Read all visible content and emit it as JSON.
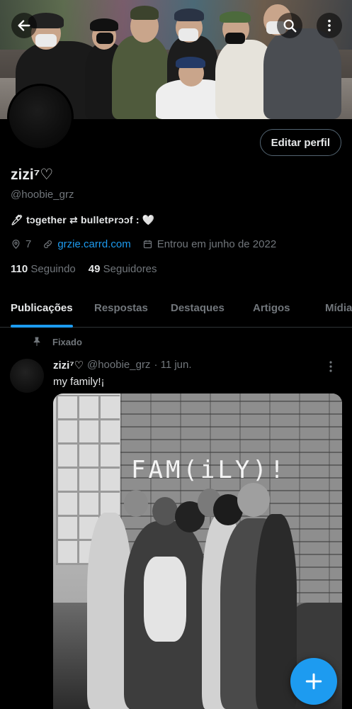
{
  "profile": {
    "display_name": "zizi⁷♡",
    "handle": "@hoobie_grz",
    "bio": "🖊 tɔgether ⇄ bulletᴘrɔɔf : 🤍",
    "location": "7",
    "website": "grzie.carrd.com",
    "joined": "Entrou em junho de 2022",
    "following_count": "110",
    "following_label": "Seguindo",
    "followers_count": "49",
    "followers_label": "Seguidores",
    "edit_button": "Editar perfil"
  },
  "tabs": [
    {
      "label": "Publicações"
    },
    {
      "label": "Respostas"
    },
    {
      "label": "Destaques"
    },
    {
      "label": "Artigos"
    },
    {
      "label": "Mídia"
    }
  ],
  "post": {
    "pinned_label": "Fixado",
    "author_name": "zizi⁷♡",
    "author_handle": "@hoobie_grz",
    "date": "· 11 jun.",
    "text": "my family!¡",
    "image_caption_text": "FAM(iLY)!"
  },
  "colors": {
    "background": "#000000",
    "accent": "#1d9bf0",
    "text_primary": "#e7e9ea",
    "text_secondary": "#71767b"
  },
  "icons": {
    "back": "arrow-left-icon",
    "search": "search-icon",
    "more": "more-vertical-icon",
    "location": "location-pin-icon",
    "link": "link-icon",
    "calendar": "calendar-icon",
    "pin": "pin-icon",
    "compose": "plus-icon"
  }
}
